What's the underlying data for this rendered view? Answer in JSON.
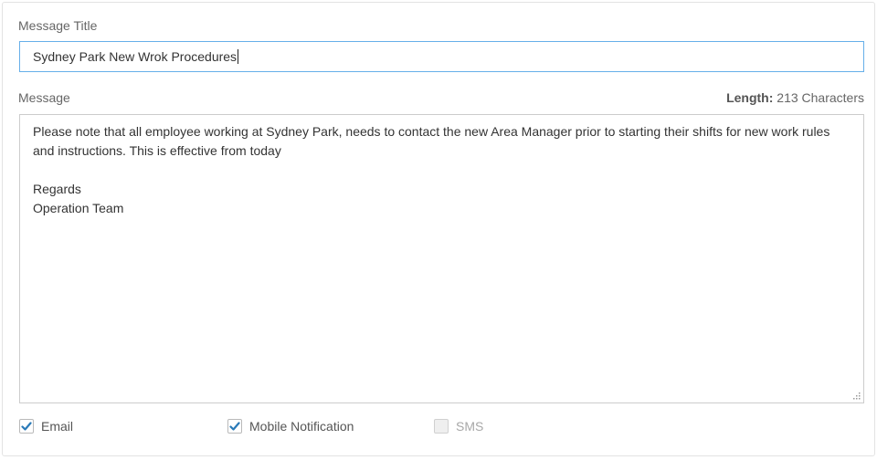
{
  "form": {
    "title_label": "Message Title",
    "title_value": "Sydney Park New Wrok Procedures",
    "message_label": "Message",
    "length_label": "Length:",
    "length_value": "213 Characters",
    "message_value": "Please note that all employee working at Sydney Park, needs to contact the new Area Manager prior to starting their shifts for new work rules and instructions. This is effective from today\n\nRegards\nOperation Team"
  },
  "channels": [
    {
      "label": "Email",
      "checked": true,
      "disabled": false
    },
    {
      "label": "Mobile Notification",
      "checked": true,
      "disabled": false
    },
    {
      "label": "SMS",
      "checked": false,
      "disabled": true
    }
  ],
  "colors": {
    "check_accent": "#2a7ab8",
    "focus_border": "#66afe9"
  },
  "icons": {
    "checkmark": "checkmark-icon",
    "resize": "resize-grip-icon"
  }
}
